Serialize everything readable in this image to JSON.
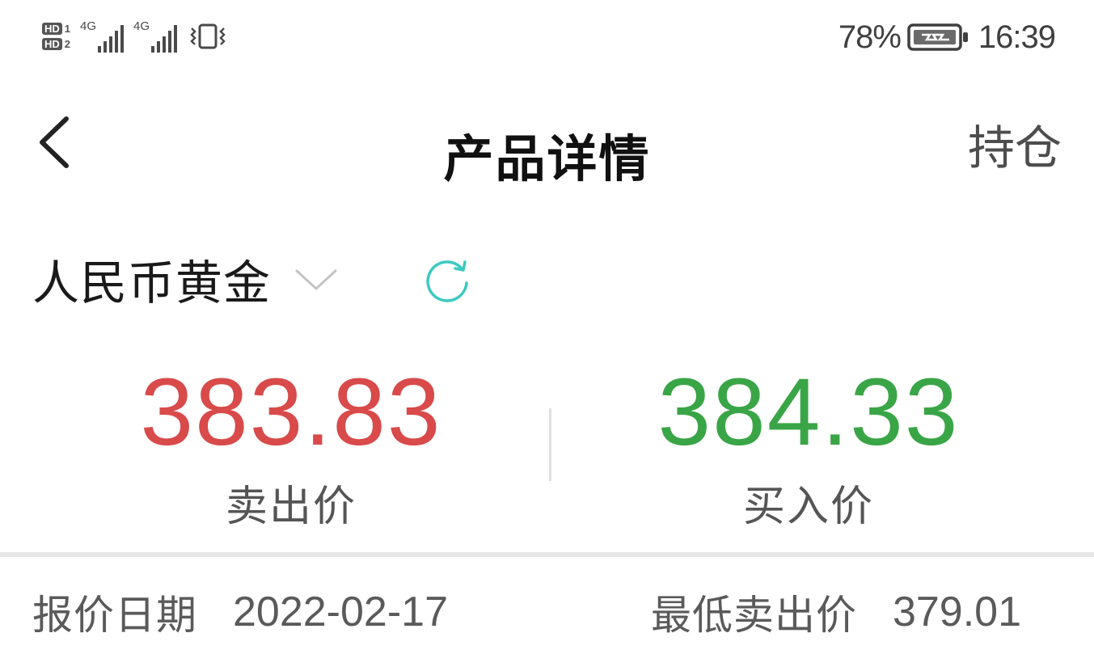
{
  "status_bar": {
    "sim1_badge": "HD",
    "sim1_index": "1",
    "sim2_badge": "HD",
    "sim2_index": "2",
    "signal1_label": "4G",
    "signal2_label": "4G",
    "battery_percent": "78%",
    "time": "16:39",
    "icons": [
      "hd-icon",
      "signal-icon",
      "vibrate-icon",
      "battery-icon"
    ]
  },
  "header": {
    "back_icon": "chevron-left-icon",
    "title": "产品详情",
    "holdings_label": "持仓"
  },
  "product": {
    "name": "人民币黄金",
    "dropdown_icon": "chevron-down-icon",
    "refresh_icon": "refresh-icon",
    "refresh_color": "#3cc9c0"
  },
  "prices": {
    "sell_value": "383.83",
    "sell_label": "卖出价",
    "sell_color": "#d94a4a",
    "buy_value": "384.33",
    "buy_label": "买入价",
    "buy_color": "#3aa546"
  },
  "info": {
    "quote_date_label": "报价日期",
    "quote_date_value": "2022-02-17",
    "min_sell_label": "最低卖出价",
    "min_sell_value": "379.01"
  }
}
